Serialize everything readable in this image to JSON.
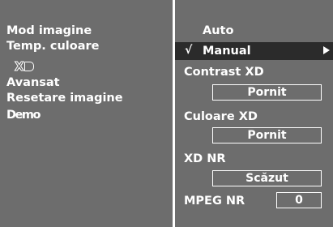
{
  "left_menu": {
    "items": [
      "Mod imagine",
      "Temp. culoare",
      "Avansat",
      "Resetare imagine"
    ],
    "xd_logo_text": "XD",
    "demo_label": "Demo"
  },
  "right_menu": {
    "auto_label": "Auto",
    "manual_check": "√",
    "manual_label": "Manual",
    "contrast_xd_label": "Contrast XD",
    "contrast_xd_value": "Pornit",
    "culoare_xd_label": "Culoare XD",
    "culoare_xd_value": "Pornit",
    "xd_nr_label": "XD NR",
    "xd_nr_value": "Scăzut",
    "mpeg_nr_label": "MPEG NR",
    "mpeg_nr_value": "0"
  },
  "colors": {
    "panel_bg": "#6d6d6d",
    "highlight_bg": "#2b2b2b",
    "text": "#ffffff"
  }
}
